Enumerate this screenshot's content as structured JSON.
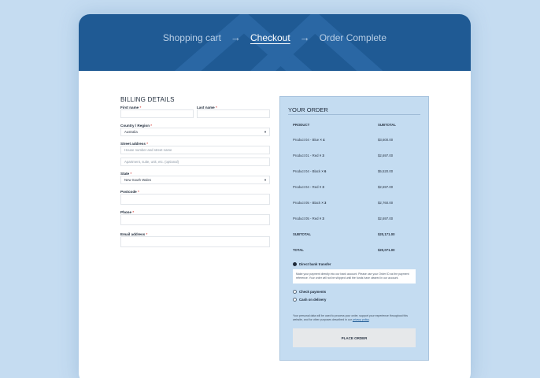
{
  "breadcrumb": {
    "steps": [
      "Shopping cart",
      "Checkout",
      "Order Complete"
    ],
    "arrow": "→"
  },
  "billing": {
    "title": "BILLING DETAILS",
    "first_name": {
      "label": "First name",
      "req": "*",
      "value": ""
    },
    "last_name": {
      "label": "Last name",
      "req": "*",
      "value": ""
    },
    "country": {
      "label": "Country / Region",
      "req": "*",
      "value": "Australia"
    },
    "street": {
      "label": "Street address",
      "req": "*",
      "placeholder1": "House number and street name",
      "placeholder2": "Apartment, suite, unit, etc. (optional)"
    },
    "state": {
      "label": "State",
      "req": "*",
      "value": "New South Wales"
    },
    "postcode": {
      "label": "Postcode",
      "req": "*",
      "value": ""
    },
    "phone": {
      "label": "Phone",
      "req": "*",
      "value": ""
    },
    "email": {
      "label": "Email address",
      "req": "*",
      "value": ""
    }
  },
  "order": {
    "title": "YOUR ORDER",
    "col_product": "PRODUCT",
    "col_subtotal": "SUBTOTAL",
    "items": [
      {
        "name": "Product 04 - Blue",
        "qty": "× 4",
        "subtotal": "$3,600.00"
      },
      {
        "name": "Product 01 - Red",
        "qty": "× 3",
        "subtotal": "$2,697.00"
      },
      {
        "name": "Product 04 - Black",
        "qty": "× 6",
        "subtotal": "$5,520.00"
      },
      {
        "name": "Product 04 - Red",
        "qty": "× 3",
        "subtotal": "$2,697.00"
      },
      {
        "name": "Product 05 - Black",
        "qty": "× 3",
        "subtotal": "$2,760.00"
      },
      {
        "name": "Product 05 - Red",
        "qty": "× 3",
        "subtotal": "$2,697.00"
      }
    ],
    "subtotal_label": "SUBTOTAL",
    "subtotal_value": "$20,171.00",
    "total_label": "TOTAL",
    "total_value": "$20,071.00",
    "payment": {
      "bank": "Direct bank transfer",
      "bank_desc": "Make your payment directly into our bank account. Please use your Order ID as the payment reference. Your order will not be shipped until the funds have cleared in our account.",
      "cheque": "Check payments",
      "cod": "Cash on delivery"
    },
    "privacy_text": "Your personal data will be used to process your order, support your experience throughout this website, and for other purposes described in our",
    "privacy_link": "privacy policy",
    "place_order": "PLACE ORDER"
  },
  "colors": {
    "hero": "#1f5a94",
    "page_bg": "#c5dcf1",
    "order_bg": "#c4dcf1"
  }
}
